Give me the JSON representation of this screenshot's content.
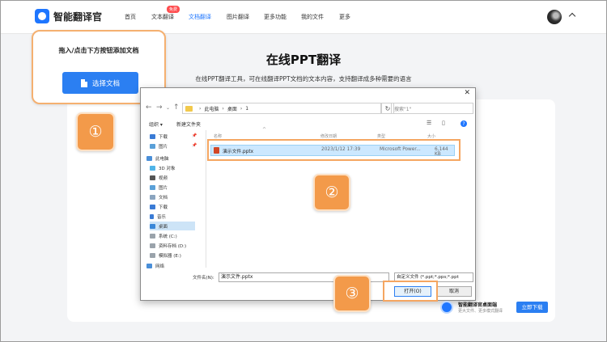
{
  "brand": {
    "name": "智能翻译官"
  },
  "nav": {
    "items": [
      "首页",
      "文本翻译",
      "文档翻译",
      "图片翻译",
      "更多功能",
      "我的文件",
      "更多"
    ],
    "active_index": 2,
    "badge": "免费"
  },
  "main": {
    "title": "在线PPT翻译",
    "description": "在线PPT翻译工具，可在线翻译PPT文档的文本内容，支持翻译成多种需要的语言"
  },
  "tooltip": {
    "text": "拖入/点击下方按钮添加文档",
    "button_label": "选择文档",
    "step": "①"
  },
  "dialog": {
    "close": "✕",
    "path": [
      "此电脑",
      "桌面",
      "1"
    ],
    "search_placeholder": "搜索\"1\"",
    "toolbar": {
      "organize": "组织 ▾",
      "new_folder": "新建文件夹"
    },
    "sidebar": [
      {
        "label": "下载",
        "icon": "download-icon",
        "pinned": true
      },
      {
        "label": "图片",
        "icon": "pictures-icon",
        "pinned": true
      },
      {
        "label": "此电脑",
        "icon": "computer-icon"
      },
      {
        "label": "3D 对象",
        "icon": "3d-objects-icon"
      },
      {
        "label": "视频",
        "icon": "video-icon"
      },
      {
        "label": "图片",
        "icon": "pictures-icon"
      },
      {
        "label": "文档",
        "icon": "documents-icon"
      },
      {
        "label": "下载",
        "icon": "download-icon"
      },
      {
        "label": "音乐",
        "icon": "music-icon"
      },
      {
        "label": "桌面",
        "icon": "desktop-icon",
        "selected": true
      },
      {
        "label": "系统 (C:)",
        "icon": "drive-icon"
      },
      {
        "label": "资料存档 (D:)",
        "icon": "drive-icon"
      },
      {
        "label": "模拟器 (E:)",
        "icon": "drive-icon"
      },
      {
        "label": "网络",
        "icon": "network-icon"
      }
    ],
    "columns": [
      "名称",
      "修改日期",
      "类型",
      "大小"
    ],
    "files": [
      {
        "name": "演示文件.pptx",
        "date": "2023/1/12 17:39",
        "type": "Microsoft Power...",
        "size": "6,144 KB",
        "icon": "pptx-file-icon"
      }
    ],
    "filename_label": "文件名(N):",
    "filename_value": "演示文件.pptx",
    "filetype_value": "自定义文件 (*.ppt;*.pps;*.ppt",
    "open_label": "打开(O)",
    "cancel_label": "取消"
  },
  "steps": {
    "two": "②",
    "three": "③"
  },
  "download": {
    "title": "智能翻译官桌面端",
    "subtitle": "更大文件、更多模式翻译",
    "button": "立即下载"
  }
}
